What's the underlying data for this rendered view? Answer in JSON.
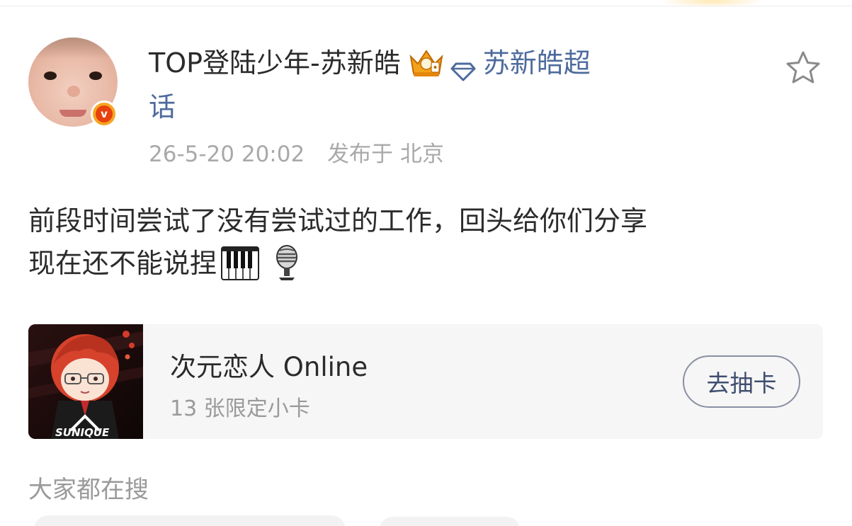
{
  "post": {
    "author_name": "TOP登陆少年-苏新皓",
    "super_topic_label_part1": "苏新皓超",
    "super_topic_label_part2": "话",
    "timestamp": "26-5-20 20:02",
    "location": "发布于 北京",
    "content_line1": "前段时间尝试了没有尝试过的工作，回头给你们分享",
    "content_line2": "现在还不能说捏",
    "icons": {
      "avatar_badge": "verified-v-icon",
      "crown": "crown-badge-icon",
      "super_topic": "diamond-icon",
      "favorite": "star-outline-icon",
      "emoji1": "piano-keyboard-icon",
      "emoji2": "microphone-icon"
    }
  },
  "card": {
    "title": "次元恋人 Online",
    "subtitle": "13 张限定小卡",
    "button_label": "去抽卡",
    "thumb_brand": "SUNIQUE"
  },
  "section": {
    "title": "大家都在搜"
  },
  "colors": {
    "link_blue": "#4d6b9c",
    "meta_gray": "#a9a9a9",
    "verified_orange": "#f5a623"
  }
}
